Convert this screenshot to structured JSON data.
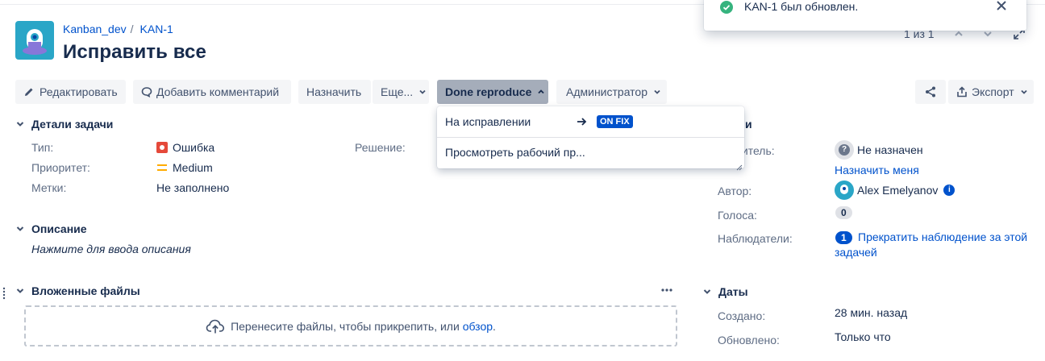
{
  "breadcrumbs": {
    "project": "Kanban_dev",
    "issue_key": "KAN-1"
  },
  "issue": {
    "title": "Исправить все"
  },
  "pager": {
    "text": "1 из 1"
  },
  "toolbar": {
    "edit": "Редактировать",
    "comment": "Добавить комментарий",
    "assign": "Назначить",
    "more": "Еще...",
    "status": "Done reproduce",
    "admin": "Администратор",
    "export": "Экспорт"
  },
  "status_menu": {
    "items": [
      {
        "label": "На исправлении",
        "lozenge": "ON FIX"
      },
      {
        "label": "Просмотреть рабочий пр..."
      }
    ]
  },
  "flag": {
    "message": "KAN-1 был обновлен."
  },
  "details": {
    "heading": "Детали задачи",
    "type_label": "Тип:",
    "type_value": "Ошибка",
    "priority_label": "Приоритет:",
    "priority_value": "Medium",
    "labels_label": "Метки:",
    "labels_value": "Не заполнено",
    "resolution_label": "Решение:"
  },
  "description": {
    "heading": "Описание",
    "placeholder": "Нажмите для ввода описания"
  },
  "attachments": {
    "heading": "Вложенные файлы",
    "drop_text": "Перенесите файлы, чтобы прикрепить, или",
    "browse": "обзор",
    "dot": "."
  },
  "people": {
    "heading_partial": "и",
    "assignee_label": "лнитель:",
    "assignee_value": "Не назначен",
    "assign_me": "Назначить меня",
    "reporter_label": "Автор:",
    "reporter_value": "Alex Emelyanov",
    "votes_label": "Голоса:",
    "votes_value": "0",
    "watchers_label": "Наблюдатели:",
    "watchers_count": "1",
    "watch_line1": "Прекратить наблюдение за этой",
    "watch_line2": "задачей"
  },
  "dates": {
    "heading": "Даты",
    "created_label": "Создано:",
    "created_value": "28 мин. назад",
    "updated_label": "Обновлено:",
    "updated_value": "Только что"
  },
  "colors": {
    "accent": "#0052cc",
    "bug": "#e5493a",
    "medium": "#ffab00",
    "success": "#36b37e",
    "avatar": "#2aa6c7"
  }
}
